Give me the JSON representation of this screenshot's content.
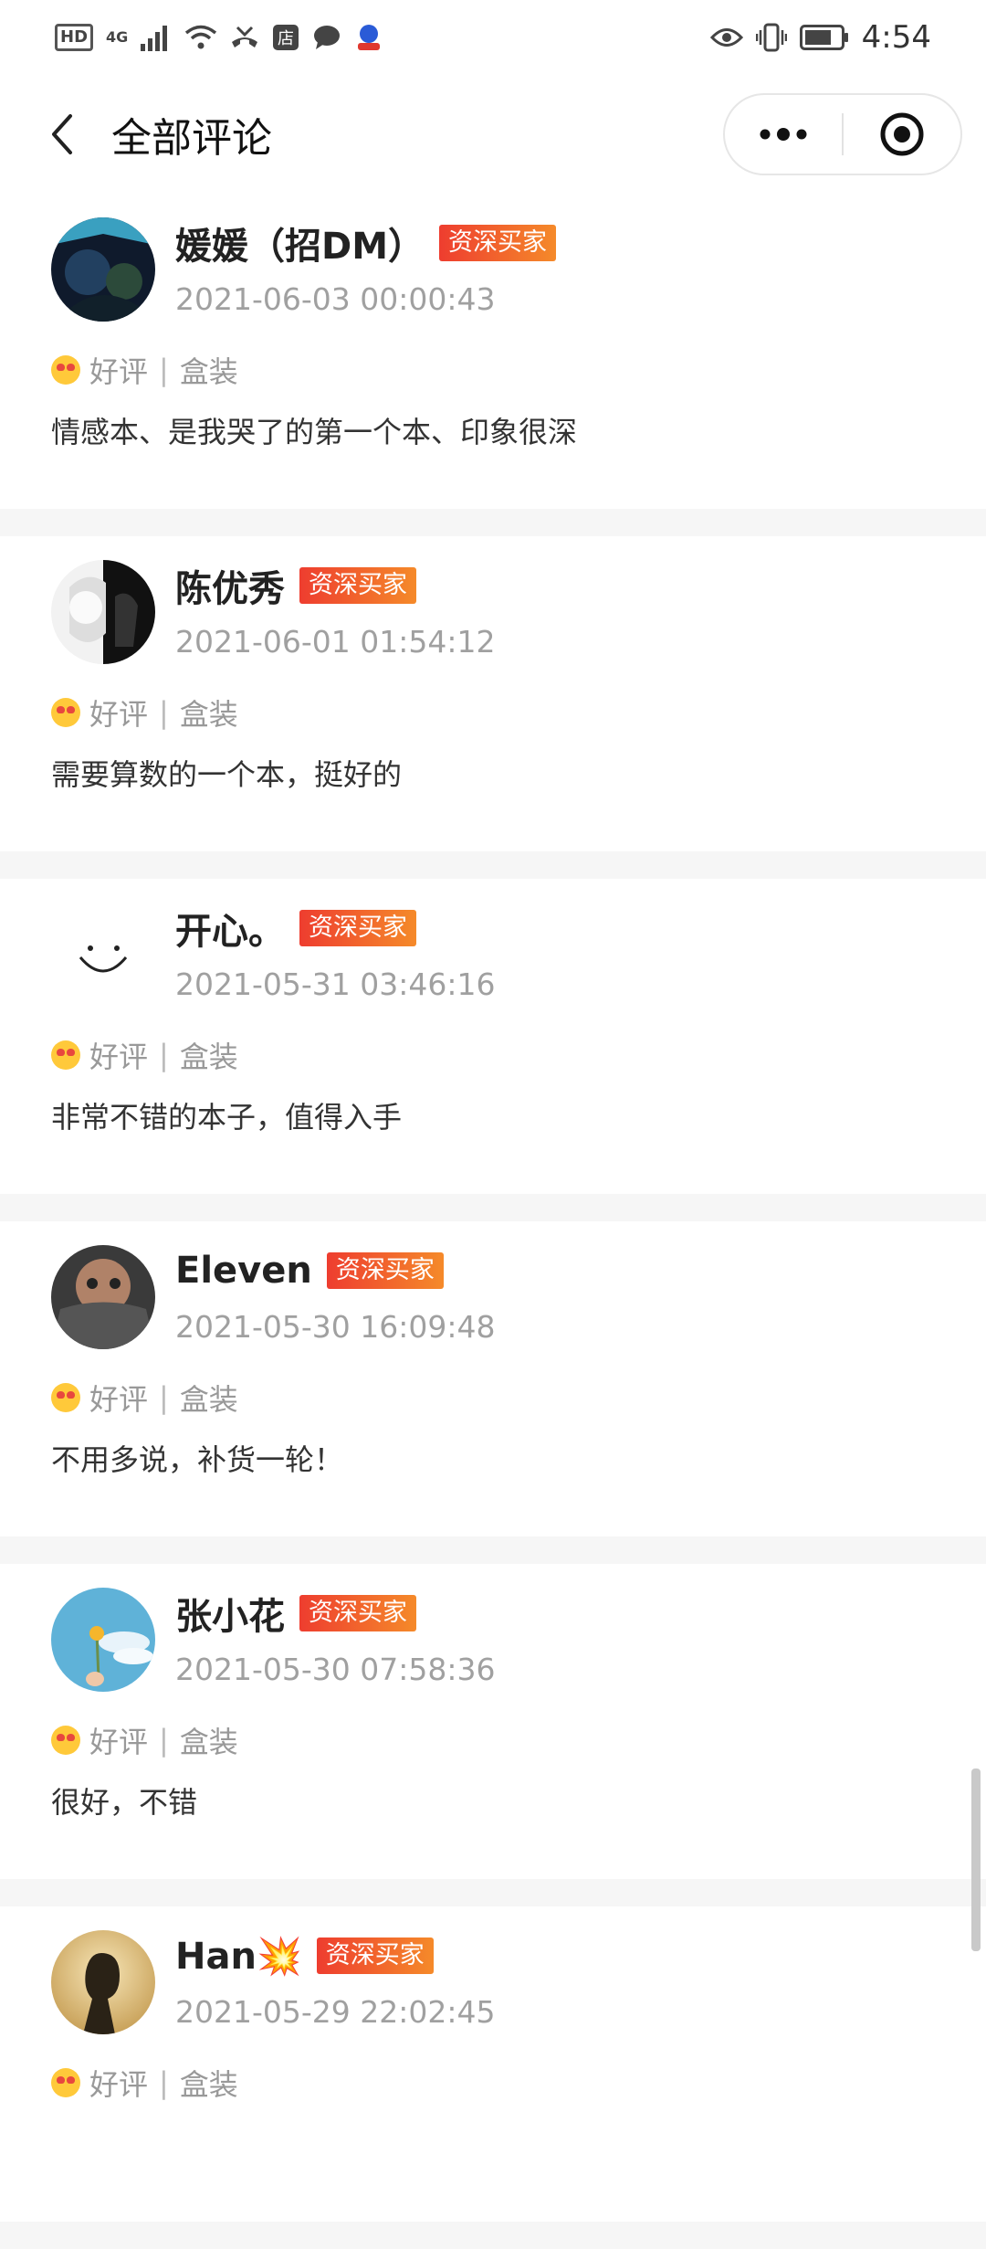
{
  "status_bar": {
    "time": "4:54",
    "hd": "HD",
    "net": "4G"
  },
  "nav": {
    "title": "全部评论"
  },
  "reviews": [
    {
      "name": "媛媛（招DM）",
      "badge": "资深买家",
      "date": "2021-06-03 00:00:43",
      "rating": "好评",
      "package": "盒装",
      "comment": "情感本、是我哭了的第一个本、印象很深"
    },
    {
      "name": "陈优秀",
      "badge": "资深买家",
      "date": "2021-06-01 01:54:12",
      "rating": "好评",
      "package": "盒装",
      "comment": "需要算数的一个本，挺好的"
    },
    {
      "name": "开心。",
      "badge": "资深买家",
      "date": "2021-05-31 03:46:16",
      "rating": "好评",
      "package": "盒装",
      "comment": "非常不错的本子，值得入手"
    },
    {
      "name": "Eleven",
      "badge": "资深买家",
      "date": "2021-05-30 16:09:48",
      "rating": "好评",
      "package": "盒装",
      "comment": "不用多说，补货一轮！"
    },
    {
      "name": "张小花",
      "badge": "资深买家",
      "date": "2021-05-30 07:58:36",
      "rating": "好评",
      "package": "盒装",
      "comment": "很好，不错"
    },
    {
      "name": "Han💥",
      "badge": "资深买家",
      "date": "2021-05-29 22:02:45",
      "rating": "好评",
      "package": "盒装",
      "comment": ""
    }
  ],
  "icons": {
    "back": "chevron-left-icon",
    "more": "more-dots-icon",
    "close": "target-close-icon",
    "rating_emoji": "heart-eyes-emoji-icon"
  }
}
